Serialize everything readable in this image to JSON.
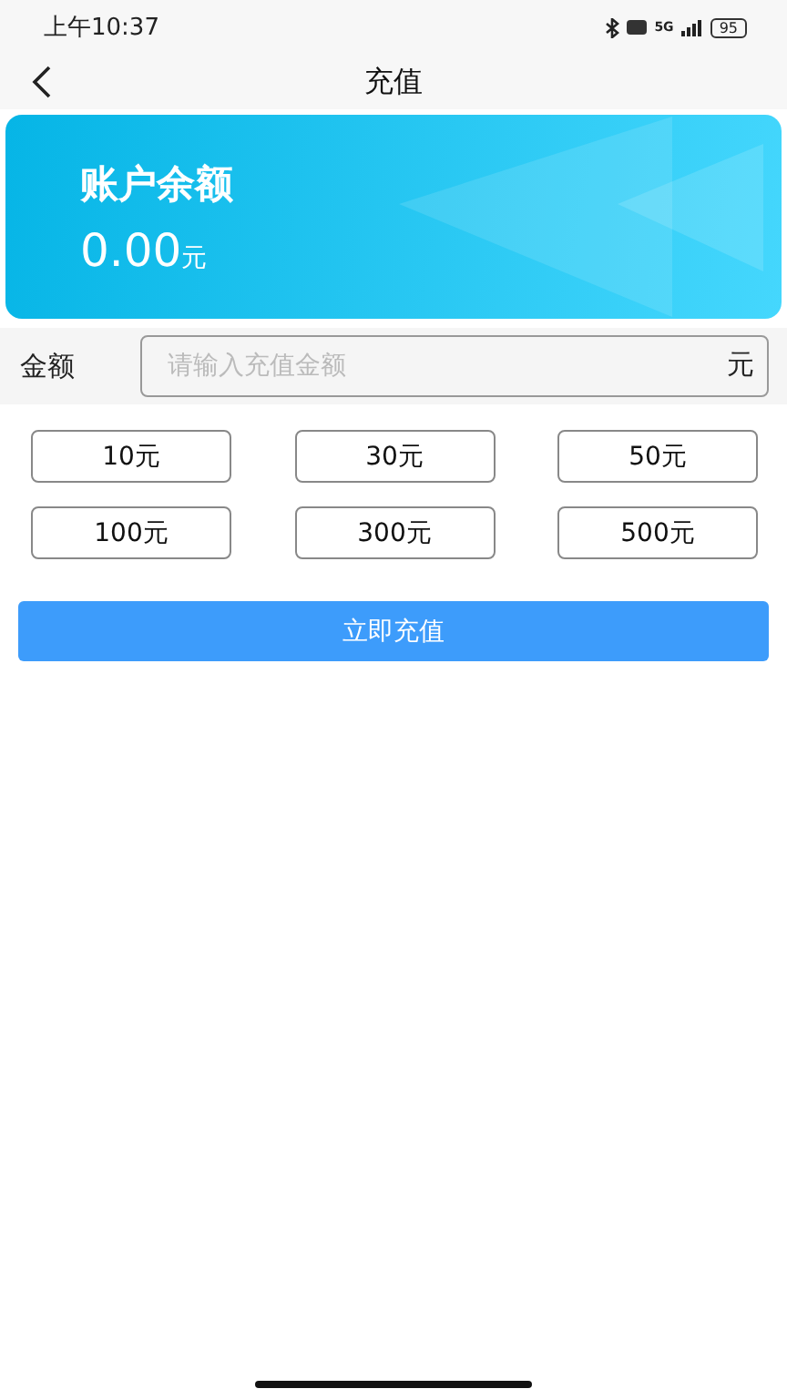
{
  "status_bar": {
    "time": "上午10:37",
    "network": "5G",
    "battery": "95"
  },
  "nav": {
    "title": "充值"
  },
  "balance_card": {
    "label": "账户余额",
    "amount": "0.00",
    "unit": "元"
  },
  "amount_field": {
    "label": "金额",
    "placeholder": "请输入充值金额",
    "unit": "元"
  },
  "presets": [
    "10元",
    "30元",
    "50元",
    "100元",
    "300元",
    "500元"
  ],
  "submit": "立即充值"
}
